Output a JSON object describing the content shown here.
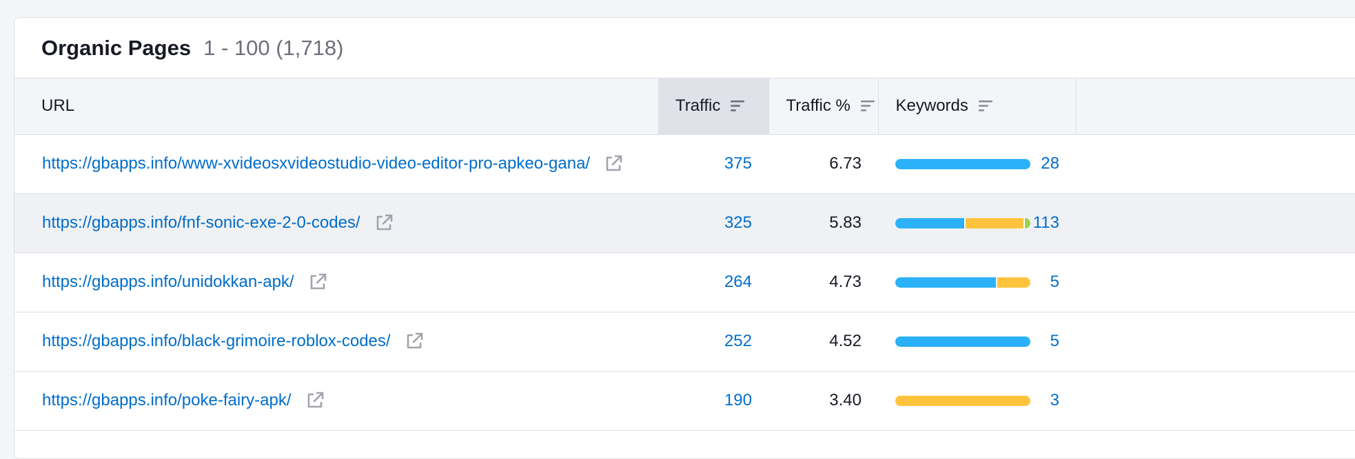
{
  "header": {
    "title": "Organic Pages",
    "count": "1 - 100 (1,718)"
  },
  "columns": {
    "url": "URL",
    "traffic": "Traffic",
    "traffic_pct": "Traffic %",
    "keywords": "Keywords"
  },
  "icons": {
    "sort": "sort-icon",
    "external": "external-link-icon"
  },
  "colors": {
    "link": "#006dca",
    "bar_blue": "#2bb1f8",
    "bar_orange": "#ffc33e",
    "bar_green": "#9bd351",
    "sorted_header": "#e0e1e9"
  },
  "rows": [
    {
      "url": "https://gbapps.info/www-xvideosxvideostudio-video-editor-pro-apkeo-gana/",
      "traffic": "375",
      "traffic_pct": "6.73",
      "keywords": "28",
      "kw_distribution": [
        {
          "color": "#2bb1f8",
          "percent": 100
        }
      ]
    },
    {
      "url": "https://gbapps.info/fnf-sonic-exe-2-0-codes/",
      "traffic": "325",
      "traffic_pct": "5.83",
      "keywords": "113",
      "kw_distribution": [
        {
          "color": "#2bb1f8",
          "percent": 52
        },
        {
          "color": "#ffc33e",
          "percent": 44
        },
        {
          "color": "#9bd351",
          "percent": 4
        }
      ]
    },
    {
      "url": "https://gbapps.info/unidokkan-apk/",
      "traffic": "264",
      "traffic_pct": "4.73",
      "keywords": "5",
      "kw_distribution": [
        {
          "color": "#2bb1f8",
          "percent": 75
        },
        {
          "color": "#ffc33e",
          "percent": 25
        }
      ]
    },
    {
      "url": "https://gbapps.info/black-grimoire-roblox-codes/",
      "traffic": "252",
      "traffic_pct": "4.52",
      "keywords": "5",
      "kw_distribution": [
        {
          "color": "#2bb1f8",
          "percent": 100
        }
      ]
    },
    {
      "url": "https://gbapps.info/poke-fairy-apk/",
      "traffic": "190",
      "traffic_pct": "3.40",
      "keywords": "3",
      "kw_distribution": [
        {
          "color": "#ffc33e",
          "percent": 100
        }
      ]
    }
  ]
}
